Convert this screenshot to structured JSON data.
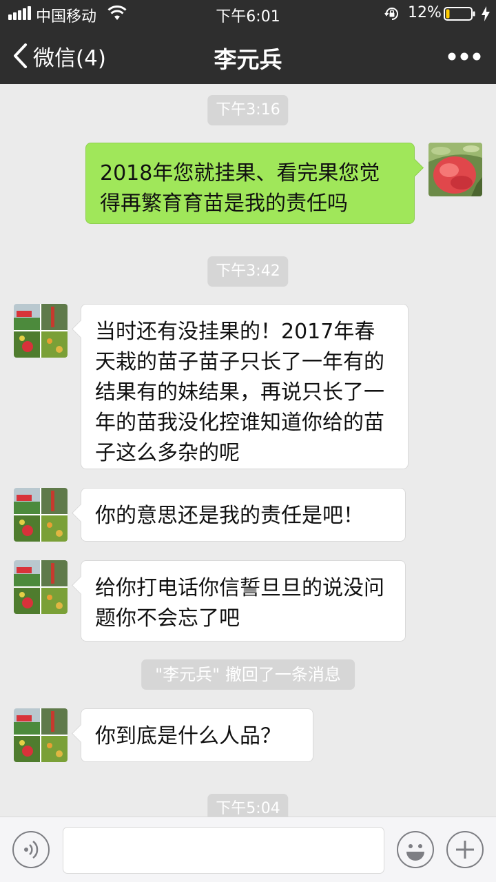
{
  "status_bar": {
    "carrier": "中国移动",
    "time": "下午6:01",
    "battery_percent": "12%",
    "battery_level": 0.12
  },
  "nav": {
    "back_label": "微信(4)",
    "title": "李元兵",
    "icons": {
      "back": "chevron-left-icon",
      "more": "more-dots-icon"
    }
  },
  "messages": {
    "t1": "下午3:16",
    "m1": "2018年您就挂果、看完果您觉得再繁育育苗是我的责任吗",
    "t2": "下午3:42",
    "m2": "当时还有没挂果的！2017年春天栽的苗子苗子只长了一年有的结果有的妹结果，再说只长了一年的苗我没化控谁知道你给的苗子这么多杂的呢",
    "m3": "你的意思还是我的责任是吧！",
    "m4": "给你打电话你信誓旦旦的说没问题你不会忘了吧",
    "recall": "\"李元兵\" 撤回了一条消息",
    "m5": "你到底是什么人品？",
    "t3": "下午5:04"
  },
  "input_bar": {
    "icons": [
      "voice-icon",
      "emoji-icon",
      "plus-icon"
    ]
  },
  "colors": {
    "header_bg": "#2e2e2e",
    "chat_bg": "#ebebeb",
    "outgoing_bubble": "#a0e75a",
    "incoming_bubble": "#ffffff",
    "battery_low": "#ffcc00"
  }
}
